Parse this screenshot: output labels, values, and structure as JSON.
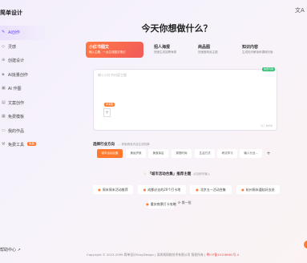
{
  "brand": "简单设计",
  "lang_icon": "translate-icon",
  "nav": [
    {
      "label": "AI创作",
      "icon": "pen-icon",
      "active": true
    },
    {
      "label": "灵感",
      "icon": "bulb-icon"
    },
    {
      "label": "创建设计",
      "icon": "plus-icon"
    },
    {
      "label": "AI批量创作",
      "icon": "layers-icon"
    },
    {
      "label": "AI 作图",
      "icon": "image-icon"
    },
    {
      "label": "文案创作",
      "icon": "doc-icon"
    },
    {
      "label": "免费模板",
      "icon": "template-icon"
    },
    {
      "label": "我的作品",
      "icon": "folder-icon"
    },
    {
      "label": "免费工具",
      "icon": "tool-icon",
      "badge": "免费"
    }
  ],
  "help": "帮助中心",
  "main_title": "今天你想做什么？",
  "modes": [
    {
      "title": "小红书图文",
      "desc": "输入主题，一点生成图文笔记",
      "selected": true
    },
    {
      "title": "招人海报",
      "desc": "快速生成招聘海报"
    },
    {
      "title": "商品图",
      "desc": "快速做商品主图"
    },
    {
      "title": "知识内容",
      "desc": "生成知识解读和课程封面"
    }
  ],
  "editor": {
    "placeholder": "输入小红书内容主题",
    "tag": "免费可用",
    "ref_label": "参考图",
    "count": "0 / 1000"
  },
  "industry": {
    "label": "选择行业方向",
    "hint": "— 获取精准内容生成效果",
    "chips": [
      "城市活动合集",
      "美妆护肤",
      "美食探店",
      "穿搭时尚",
      "生活方式",
      "考试学习",
      "输入行业..."
    ],
    "more": "+"
  },
  "topics": {
    "title": "「城市活动合集」推荐主题",
    "subtitle": "点击即可输入",
    "items": [
      "周末周末活动推荐",
      "成都必去的20个打卡地",
      "北京五一活动合集",
      "杭州周末遛娃好去处",
      "重庆夜景打卡攻略"
    ],
    "refresh": "换一批"
  },
  "footer": {
    "copyright": "Copyright © 2023-2099 简单设计EasyDesign | 深圳易网络技术有限公司 版权所有 | ",
    "icp": "粤ICP备19108862号-4"
  }
}
